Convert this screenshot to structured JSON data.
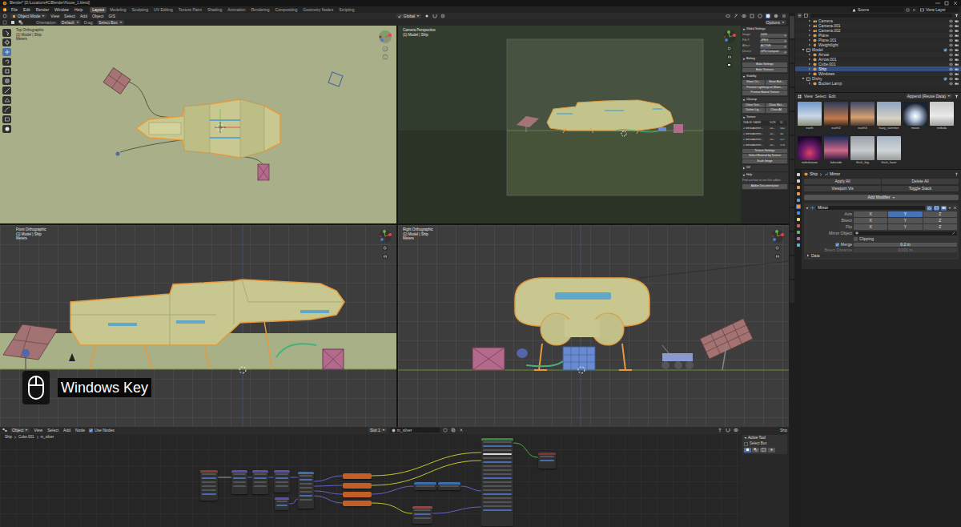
{
  "window": {
    "title": "Blender* [D:\\Locations4C\\Blender\\House_1.blend]"
  },
  "menu": [
    "File",
    "Edit",
    "Render",
    "Window",
    "Help"
  ],
  "workspaces": [
    {
      "label": "Layout",
      "selected": true
    },
    {
      "label": "Modeling",
      "selected": false
    },
    {
      "label": "Sculpting",
      "selected": false
    },
    {
      "label": "UV Editing",
      "selected": false
    },
    {
      "label": "Texture Paint",
      "selected": false
    },
    {
      "label": "Shading",
      "selected": false
    },
    {
      "label": "Animation",
      "selected": false
    },
    {
      "label": "Rendering",
      "selected": false
    },
    {
      "label": "Compositing",
      "selected": false
    },
    {
      "label": "Geometry Nodes",
      "selected": false
    },
    {
      "label": "Scripting",
      "selected": false
    }
  ],
  "scene": "Scene",
  "view_layer": "View Layer",
  "header": {
    "mode": "Object Mode",
    "menus": [
      "View",
      "Select",
      "Add",
      "Object",
      "GIS"
    ],
    "orientation": "Global"
  },
  "tool_header": {
    "orientation_label": "Orientation:",
    "orientation": "Default",
    "drag_label": "Drag:",
    "drag": "Select Box",
    "options": "Options"
  },
  "tools": [
    {
      "selected": false
    },
    {
      "selected": false
    },
    {
      "selected": true
    },
    {
      "selected": false
    },
    {
      "selected": false
    },
    {
      "selected": false
    },
    {
      "selected": false
    },
    {
      "selected": false
    },
    {
      "selected": false
    },
    {
      "selected": false
    },
    {
      "selected": false
    }
  ],
  "viewports": [
    {
      "title": "Top Orthographic",
      "subtitle": "(1) Model | Ship",
      "units": "Meters"
    },
    {
      "title": "Camera Perspective",
      "subtitle": "(1) Model | Ship"
    },
    {
      "title": "Front Orthographic",
      "subtitle": "(1) Model | Ship",
      "units": "Meters"
    },
    {
      "title": "Right Orthographic",
      "subtitle": "(1) Model | Ship",
      "units": "Meters"
    }
  ],
  "n_panel": {
    "sections": [
      {
        "title": "Global Settings",
        "expanded": true,
        "fields": [
          {
            "label": "Image:",
            "value": "1024"
          },
          {
            "label": "File T:",
            "value": "JPEG"
          },
          {
            "label": "Affect:",
            "value": "ACTIVE"
          },
          {
            "label": "Device:",
            "value": "GPU Compute"
          }
        ]
      },
      {
        "title": "Baking",
        "expanded": true,
        "buttons": [
          [
            "Bake Settings"
          ],
          [
            "Bake Textures"
          ]
        ]
      },
      {
        "title": "Visibility",
        "expanded": true,
        "buttons": [
          [
            "Show Ori...",
            "Show Bak..."
          ],
          [
            "Preview Lightmap on Mater..."
          ],
          [
            "Preview Baked Texture"
          ]
        ]
      },
      {
        "title": "Cleanup",
        "expanded": true,
        "buttons": [
          [
            "Clean Text...",
            "Clean Mat..."
          ],
          [
            "Delete Lig...",
            "Clean All"
          ]
        ]
      },
      {
        "title": "Texture",
        "expanded": true,
        "columns": [
          "IMAGE NAME",
          "SIZE",
          "ID"
        ],
        "rows": [
          [
            "2 MetalAlumin...",
            "10...",
            "562"
          ],
          [
            "2 MetalAlumin...",
            "10...",
            "34"
          ],
          [
            "2 MetalAlumin...",
            "10...",
            "127"
          ],
          [
            "2 MetalAlumin...",
            "10...",
            "576"
          ]
        ],
        "buttons": [
          [
            "Texture Settings"
          ],
          [
            "Select Material by Texture"
          ],
          [
            "Scale Image"
          ]
        ]
      },
      {
        "title": "UV",
        "expanded": false
      },
      {
        "title": "Help",
        "expanded": true,
        "text": "Find out how to use this addon",
        "buttons": [
          [
            "Addon Documentation"
          ]
        ]
      }
    ]
  },
  "overlay": {
    "label": "Windows Key"
  },
  "node_editor": {
    "object_type": "Object",
    "menus": [
      "View",
      "Select",
      "Add",
      "Node"
    ],
    "use_nodes": {
      "label": "Use Nodes",
      "checked": true
    },
    "slot": "Slot 1",
    "material": "m_silver",
    "breadcrumb": [
      "Ship",
      "Cube.001",
      "m_silver"
    ],
    "nodes": [
      {
        "kind": "texture"
      },
      {
        "kind": "vector"
      },
      {
        "kind": "vector"
      },
      {
        "kind": "vector"
      },
      {
        "kind": "converter"
      },
      {
        "kind": "vector"
      },
      {
        "kind": "group"
      },
      {
        "kind": "group"
      },
      {
        "kind": "group"
      },
      {
        "kind": "group"
      },
      {
        "kind": "converter"
      },
      {
        "kind": "converter"
      },
      {
        "kind": "input"
      },
      {
        "kind": "shader"
      },
      {
        "kind": "output"
      }
    ]
  },
  "tool_panel": {
    "object": "Ship",
    "title": "Active Tool",
    "tool": "Select Box"
  },
  "outliner": {
    "items": [
      {
        "name": "Camera",
        "kind": "camera",
        "selected": false
      },
      {
        "name": "Camera.001",
        "kind": "camera",
        "selected": false
      },
      {
        "name": "Camera.002",
        "kind": "camera",
        "selected": false
      },
      {
        "name": "Plane",
        "kind": "mesh",
        "selected": false
      },
      {
        "name": "Plane.001",
        "kind": "mesh",
        "selected": false
      },
      {
        "name": "Weightlight",
        "kind": "light",
        "selected": false
      },
      {
        "name": "Model",
        "kind": "collection",
        "selected": false
      },
      {
        "name": "Arrow",
        "kind": "mesh",
        "selected": false
      },
      {
        "name": "Arrow.001",
        "kind": "mesh",
        "selected": false
      },
      {
        "name": "Cube.001",
        "kind": "mesh",
        "selected": false
      },
      {
        "name": "Ship",
        "kind": "mesh",
        "selected": true
      },
      {
        "name": "Windows",
        "kind": "mesh",
        "selected": false
      },
      {
        "name": "Dishy",
        "kind": "collection",
        "selected": false
      },
      {
        "name": "Bucket Lamp",
        "kind": "mesh",
        "selected": false
      }
    ]
  },
  "assets": {
    "menus": [
      "View",
      "Select",
      "Edit"
    ],
    "import": "Append (Reuse Data)",
    "items": [
      "earth",
      "earth2",
      "earth3",
      "hazy_summer",
      "moon",
      "nebula",
      "nebulawow",
      "lakeside",
      "thick_fog",
      "thick_haze"
    ]
  },
  "properties": {
    "object": "Ship",
    "tab": "Mirror",
    "buttons": [
      [
        "Apply All",
        "Delete All"
      ],
      [
        "Viewport Vis",
        "Toggle Stack"
      ]
    ],
    "add_modifier": "Add Modifier",
    "modifier": {
      "name": "Mirror",
      "axis_rows": [
        {
          "label": "Axis",
          "toggles": [
            {
              "label": "X",
              "selected": false
            },
            {
              "label": "Y",
              "selected": true
            },
            {
              "label": "Z",
              "selected": false
            }
          ]
        },
        {
          "label": "Bisect",
          "toggles": [
            {
              "label": "X",
              "selected": false
            },
            {
              "label": "Y",
              "selected": false
            },
            {
              "label": "Z",
              "selected": false
            }
          ]
        },
        {
          "label": "Flip",
          "toggles": [
            {
              "label": "X",
              "selected": false
            },
            {
              "label": "Y",
              "selected": false
            },
            {
              "label": "Z",
              "selected": false
            }
          ]
        }
      ],
      "mirror_object": {
        "label": "Mirror Object"
      },
      "clipping": {
        "label": "Clipping",
        "checked": false
      },
      "merge": {
        "label": "Merge",
        "checked": true,
        "value": "0.2 m"
      },
      "bisect_distance": {
        "label": "Bisect Distance",
        "value": "0.001 m",
        "disabled": true
      },
      "data": {
        "label": "Data",
        "expanded": false
      }
    }
  }
}
